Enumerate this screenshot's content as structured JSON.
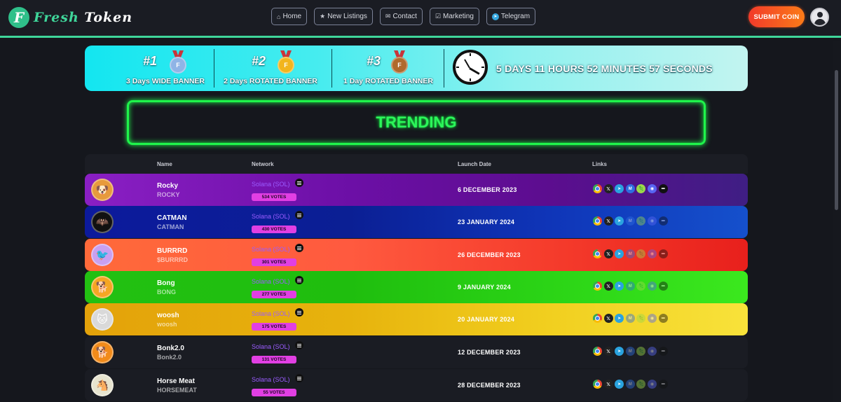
{
  "header": {
    "logo_letter": "F",
    "logo_word1": "Fresh",
    "logo_word2": "Token",
    "nav": [
      {
        "label": "Home",
        "icon": "home-icon"
      },
      {
        "label": "New Listings",
        "icon": "star-icon"
      },
      {
        "label": "Contact",
        "icon": "mail-icon"
      },
      {
        "label": "Marketing",
        "icon": "checkbox-icon"
      },
      {
        "label": "Telegram",
        "icon": "telegram-icon"
      }
    ],
    "submit_label": "SUBMIT COIN"
  },
  "promo": {
    "slots": [
      {
        "rank": "#1",
        "medal_letter": "F",
        "medal_color": "#8fb4e6",
        "desc": "3 Days WIDE BANNER"
      },
      {
        "rank": "#2",
        "medal_letter": "F",
        "medal_color": "#f2b51d",
        "desc": "2 Days ROTATED BANNER"
      },
      {
        "rank": "#3",
        "medal_letter": "F",
        "medal_color": "#b06a2c",
        "desc": "1 Day ROTATED BANNER"
      }
    ],
    "countdown": "5 DAYS 11 HOURS 52 MINUTES 57 SECONDS"
  },
  "trending": {
    "title": "TRENDING"
  },
  "table": {
    "columns": {
      "name": "Name",
      "network": "Network",
      "launch": "Launch Date",
      "links": "Links"
    },
    "rows": [
      {
        "name": "Rocky",
        "symbol": "ROCKY",
        "network": "Solana (SOL)",
        "votes": "534 VOTES",
        "date": "6 DECEMBER 2023",
        "logo": "🐶",
        "logo_bg": "#e79a3d",
        "bg": "linear-gradient(90deg,#8a1fc4 0%,#6c0fa6 40%,#5c0d8f 70%,#3f1e84 100%)",
        "links": [
          "chrome",
          "x",
          "tg",
          "cmc",
          "dex",
          "dc",
          "more"
        ],
        "dim": false
      },
      {
        "name": "CATMAN",
        "symbol": "CATMAN",
        "network": "Solana (SOL)",
        "votes": "430 VOTES",
        "date": "23 JANUARY 2024",
        "logo": "🦇",
        "logo_bg": "#111111",
        "bg": "linear-gradient(90deg,#0c1a9c 0%,#0b1f94 40%,#0f35b8 70%,#1550cc 100%)",
        "links": [
          "chrome",
          "x",
          "tg",
          "cmc",
          "dex",
          "dc",
          "more"
        ],
        "dim": true
      },
      {
        "name": "BURRRD",
        "symbol": "$BURRRD",
        "network": "Solana (SOL)",
        "votes": "301 VOTES",
        "date": "26 DECEMBER 2023",
        "logo": "🐦",
        "logo_bg": "#c9a0f0",
        "bg": "linear-gradient(90deg,#ff6a3a 0%,#ff5a3f 40%,#f53c2c 70%,#e8201c 100%)",
        "links": [
          "chrome",
          "x",
          "tg",
          "cmc",
          "dex",
          "dc",
          "more"
        ],
        "dim": true
      },
      {
        "name": "Bong",
        "symbol": "BONG",
        "network": "Solana (SOL)",
        "votes": "277 VOTES",
        "date": "9 JANUARY 2024",
        "logo": "🐕",
        "logo_bg": "#f5a623",
        "bg": "linear-gradient(90deg,#22c012 0%,#1fbe0e 40%,#2bd416 70%,#3be81e 100%)",
        "links": [
          "chrome",
          "x",
          "tg",
          "cmc",
          "dex",
          "dc",
          "more"
        ],
        "dim": true
      },
      {
        "name": "woosh",
        "symbol": "woosh",
        "network": "Solana (SOL)",
        "votes": "175 VOTES",
        "date": "20 JANUARY 2024",
        "logo": "🐱",
        "logo_bg": "#d9d9d9",
        "bg": "linear-gradient(90deg,#e3a20a 0%,#e7b30d 40%,#f1cf1f 70%,#f8e23a 100%)",
        "links": [
          "chrome",
          "x",
          "tg",
          "cmc",
          "dex",
          "dc",
          "more"
        ],
        "dim": true
      },
      {
        "name": "Bonk2.0",
        "symbol": "Bonk2.0",
        "network": "Solana (SOL)",
        "votes": "131 VOTES",
        "date": "12 DECEMBER 2023",
        "logo": "🐕",
        "logo_bg": "#f28b1a",
        "bg": "#1a1c23",
        "links": [
          "chrome",
          "x",
          "tg",
          "cmc",
          "dex",
          "dc",
          "more"
        ],
        "dim": true
      },
      {
        "name": "Horse Meat",
        "symbol": "HORSEMEAT",
        "network": "Solana (SOL)",
        "votes": "55 VOTES",
        "date": "28 DECEMBER 2023",
        "logo": "🐴",
        "logo_bg": "#e7e4cf",
        "bg": "#1a1c23",
        "links": [
          "chrome",
          "x",
          "tg",
          "cmc",
          "dex",
          "dc",
          "more"
        ],
        "dim": true
      }
    ]
  }
}
